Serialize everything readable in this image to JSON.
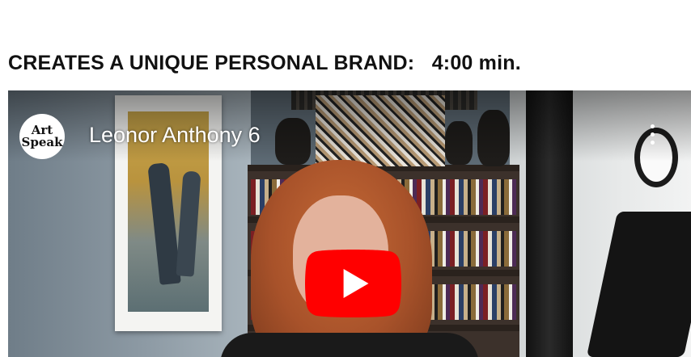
{
  "heading": "CREATES A UNIQUE PERSONAL BRAND:   4:00 min.",
  "video": {
    "title": "Leonor Anthony 6",
    "channel_avatar_line1": "Art",
    "channel_avatar_line2": "Speak",
    "play_icon": "youtube-play-icon",
    "more_icon": "kebab-menu-icon",
    "play_color": "#FF0000"
  }
}
